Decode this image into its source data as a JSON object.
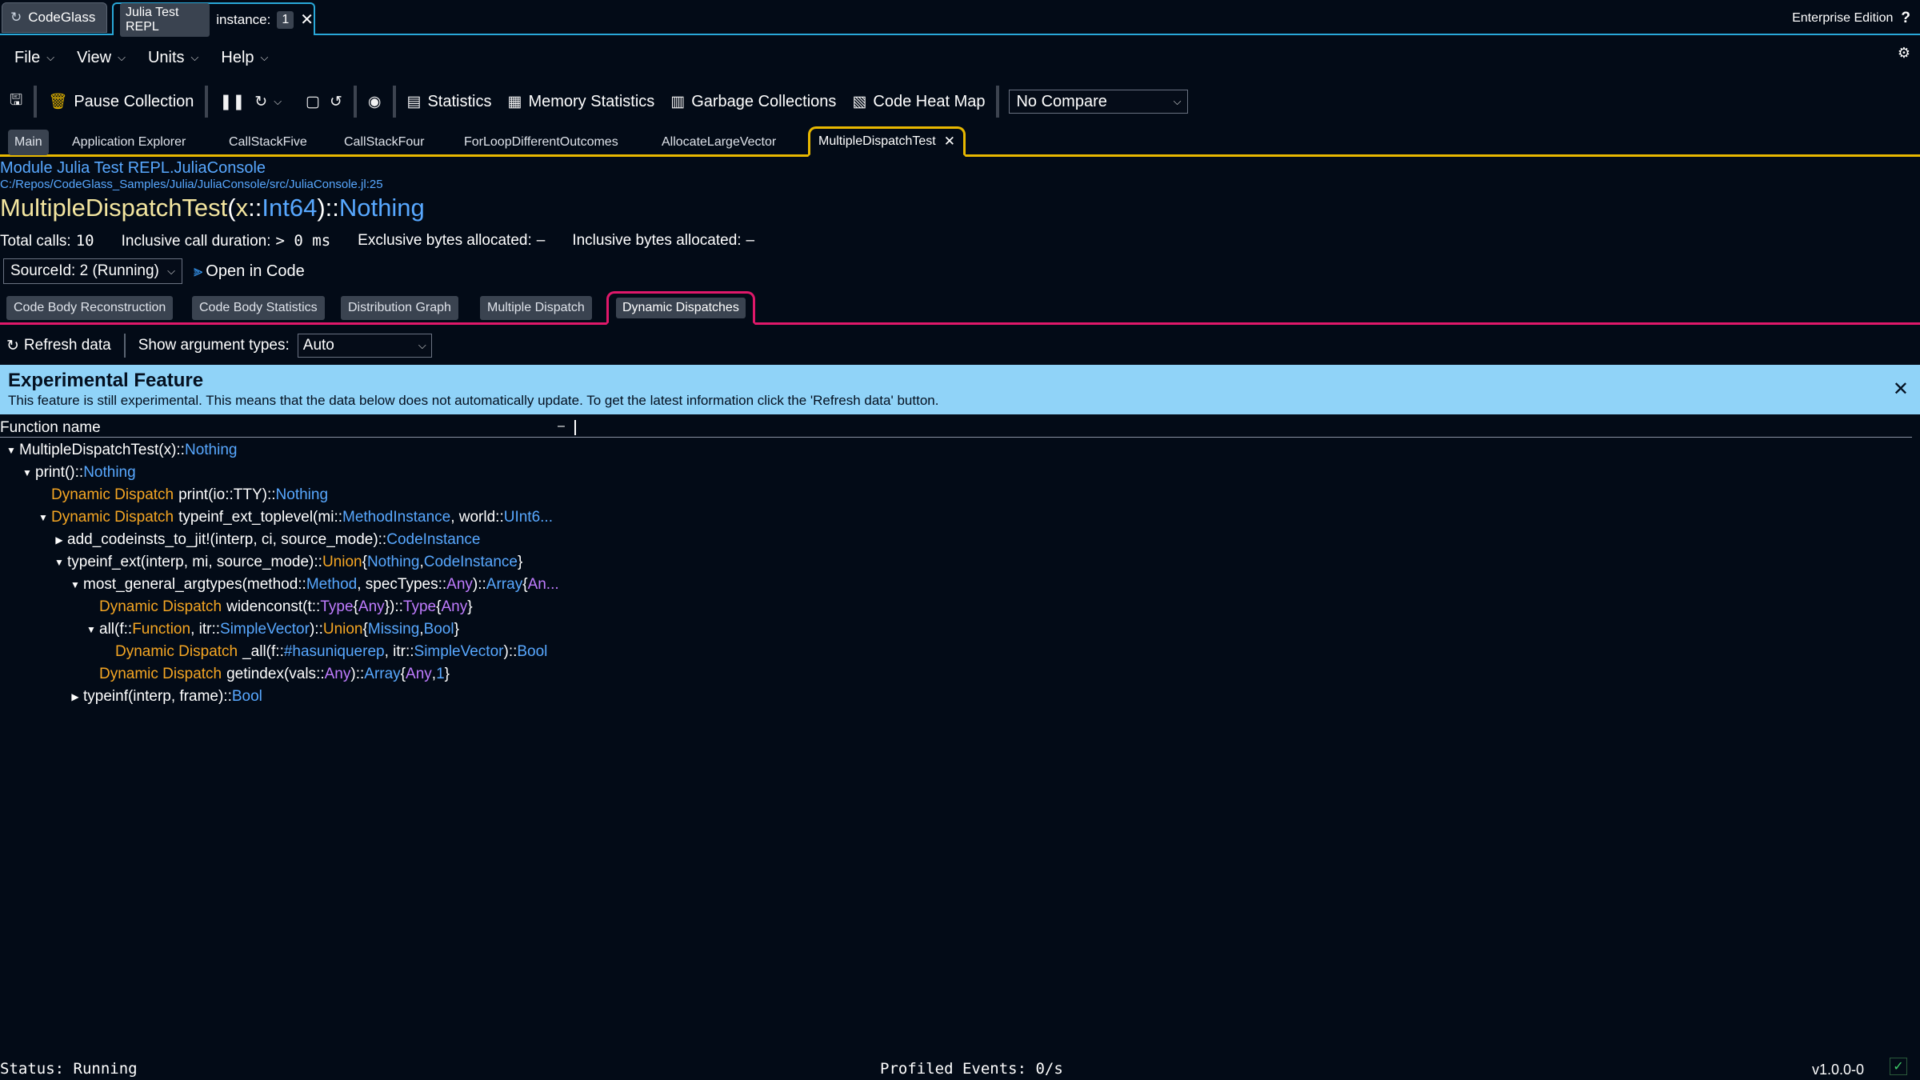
{
  "window": {
    "app_tab_label": "CodeGlass",
    "session_tab_label": "Julia Test REPL",
    "instance_label": "instance:",
    "instance_value": "1",
    "edition": "Enterprise Edition"
  },
  "menu": {
    "items": [
      "File",
      "View",
      "Units",
      "Help"
    ]
  },
  "toolbar": {
    "pause_collection": "Pause Collection",
    "statistics": "Statistics",
    "memory_statistics": "Memory Statistics",
    "garbage_collections": "Garbage Collections",
    "code_heat_map": "Code Heat Map",
    "compare_value": "No Compare"
  },
  "doc_tabs": [
    "Main",
    "Application Explorer",
    "CallStackFive",
    "CallStackFour",
    "ForLoopDifferentOutcomes",
    "AllocateLargeVector",
    "MultipleDispatchTest"
  ],
  "header": {
    "module": "Module Julia Test REPL.JuliaConsole",
    "path": "C:/Repos/CodeGlass_Samples/Julia/JuliaConsole/src/JuliaConsole.jl:25",
    "sig_name": "MultipleDispatchTest",
    "sig_param": "x",
    "sig_param_type": "Int64",
    "sig_return": "Nothing"
  },
  "stats": {
    "total_calls_label": "Total calls:",
    "total_calls_value": "10",
    "inclusive_duration_label": "Inclusive call duration:",
    "inclusive_duration_value": "> 0 ms",
    "exclusive_bytes_label": "Exclusive bytes allocated:",
    "exclusive_bytes_value": "–",
    "inclusive_bytes_label": "Inclusive bytes allocated:",
    "inclusive_bytes_value": "–"
  },
  "source": {
    "selected": "SourceId: 2 (Running)",
    "open_in_code": "Open in Code"
  },
  "view_tabs": [
    "Code Body Reconstruction",
    "Code Body Statistics",
    "Distribution Graph",
    "Multiple Dispatch",
    "Dynamic Dispatches"
  ],
  "controls": {
    "refresh": "Refresh data",
    "show_arg_label": "Show argument types:",
    "show_arg_value": "Auto"
  },
  "banner": {
    "title": "Experimental Feature",
    "text": "This feature is still experimental. This means that the data below does not automatically update. To get the latest information click the 'Refresh data' button."
  },
  "tree": {
    "column_header": "Function name",
    "split_glyph": "–",
    "dynamic_label": "Dynamic Dispatch",
    "rows": [
      [
        "MultipleDispatchTest(x)",
        "::",
        "Nothing"
      ],
      [
        "print()",
        "::",
        "Nothing"
      ],
      [
        "print(io",
        "::",
        "TTY",
        ")",
        "::",
        "Nothing"
      ],
      [
        "typeinf_ext_toplevel(mi",
        "::",
        "MethodInstance",
        ", world",
        "::",
        "UInt6..."
      ],
      [
        "add_codeinsts_to_jit!(interp, ci, source_mode)",
        "::",
        "CodeInstance"
      ],
      [
        "typeinf_ext(interp, mi, source_mode)",
        "::",
        "Union",
        "{",
        "Nothing",
        ", ",
        "CodeInstance",
        "}"
      ],
      [
        "most_general_argtypes(method",
        "::",
        "Method",
        ", specTypes",
        "::",
        "Any",
        ")",
        "::",
        "Array",
        "{",
        "An..."
      ],
      [
        "widenconst(t",
        "::",
        "Type",
        "{",
        "Any",
        "})",
        "::",
        "Type",
        "{",
        "Any",
        "}"
      ],
      [
        "all(f",
        "::",
        "Function",
        ", itr",
        "::",
        "SimpleVector",
        ")",
        "::",
        "Union",
        "{",
        "Missing",
        ", ",
        "Bool",
        "}"
      ],
      [
        "_all(f",
        "::",
        "#hasuniquerep",
        ", itr",
        "::",
        "SimpleVector",
        ")",
        "::",
        "Bool"
      ],
      [
        "getindex(vals",
        "::",
        "Any",
        ")",
        "::",
        "Array",
        "{",
        "Any",
        ", ",
        "1",
        "}"
      ],
      [
        "typeinf(interp, frame)",
        "::",
        "Bool"
      ]
    ]
  },
  "status": {
    "left": "Status: Running",
    "middle": "Profiled Events: 0/s",
    "version": "v1.0.0-0"
  }
}
